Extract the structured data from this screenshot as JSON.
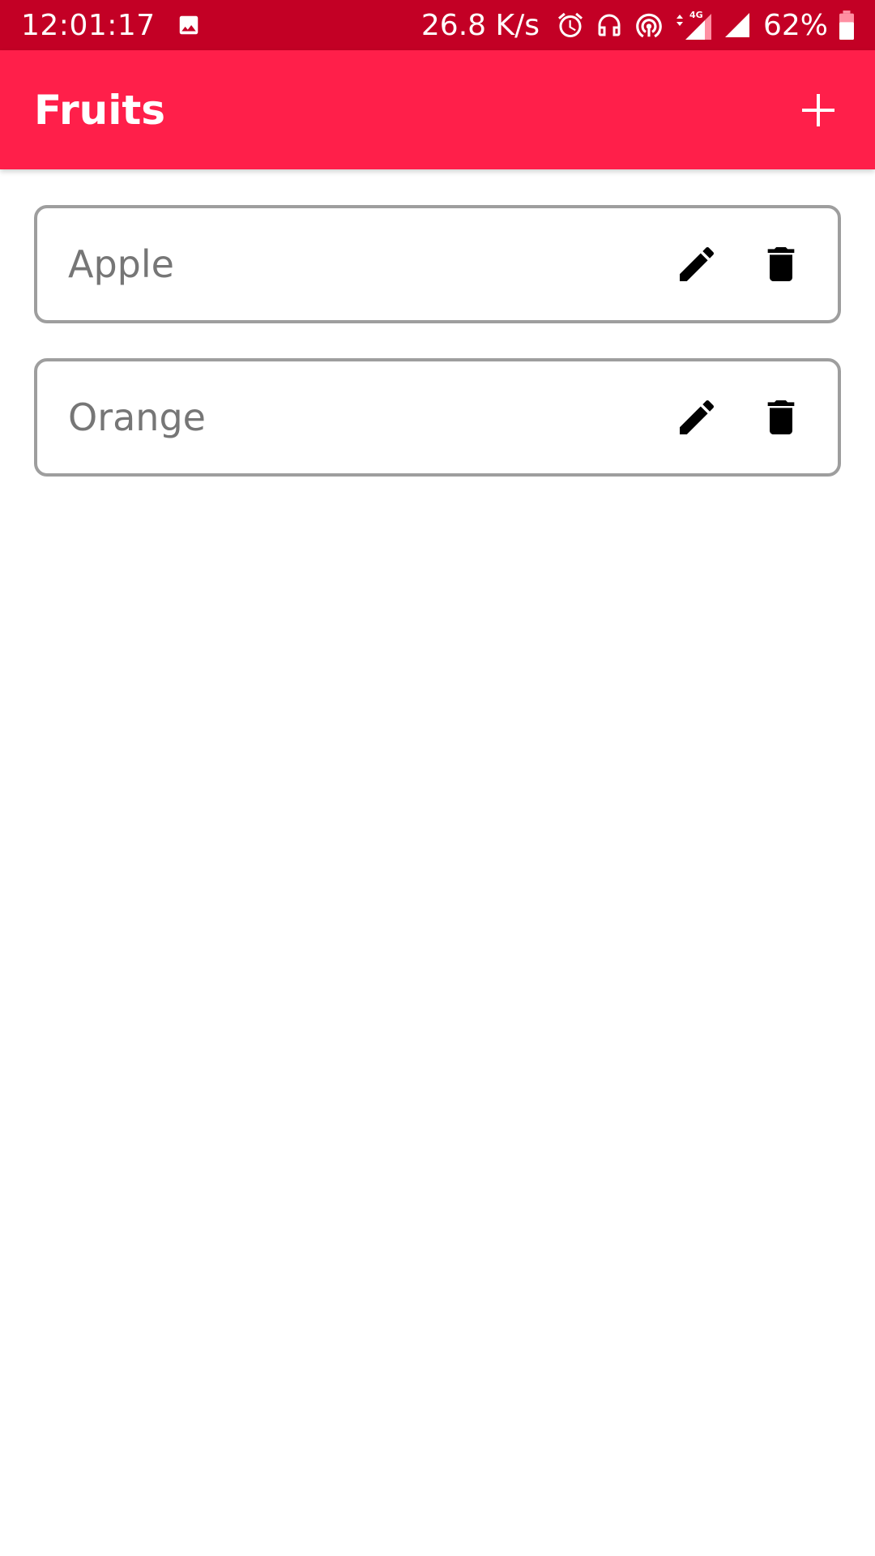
{
  "status_bar": {
    "time": "12:01:17",
    "network_speed": "26.8 K/s",
    "network_type": "4G",
    "battery_percent": "62%",
    "icons": [
      "image-icon",
      "alarm-icon",
      "headphones-icon",
      "hotspot-icon",
      "signal-4g-icon",
      "signal-icon",
      "battery-icon"
    ]
  },
  "app_bar": {
    "title": "Fruits",
    "add_icon": "plus-icon"
  },
  "items": [
    {
      "label": "Apple",
      "edit_icon": "pencil-icon",
      "delete_icon": "trash-icon"
    },
    {
      "label": "Orange",
      "edit_icon": "pencil-icon",
      "delete_icon": "trash-icon"
    }
  ],
  "colors": {
    "status_bar": "#c30025",
    "app_bar": "#ff1f4a",
    "item_border": "#9e9e9e",
    "item_text": "#767676"
  }
}
